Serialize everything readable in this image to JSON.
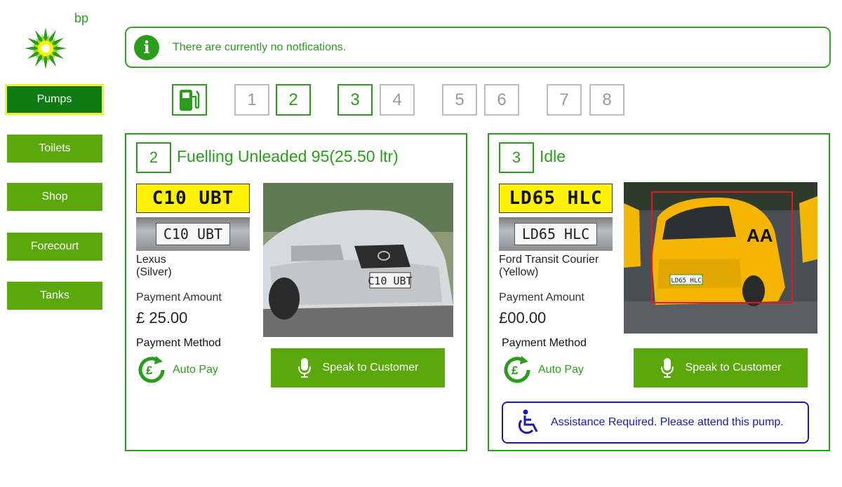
{
  "brand": {
    "logo_text": "bp"
  },
  "colors": {
    "accent": "#2a9d1d",
    "button": "#5ba80d",
    "active_nav": "#0e7b12",
    "highlight": "#f5f028",
    "plate": "#fff200",
    "assist": "#1a1ab0"
  },
  "sidebar": {
    "items": [
      {
        "label": "Pumps",
        "active": true
      },
      {
        "label": "Toilets"
      },
      {
        "label": "Shop"
      },
      {
        "label": "Forecourt"
      },
      {
        "label": "Tanks"
      }
    ]
  },
  "notification": {
    "icon": "info-icon",
    "text": "There are currently no notfications."
  },
  "pump_selector": {
    "icon": "fuel-pump-icon",
    "pumps": [
      {
        "label": "1",
        "active": false
      },
      {
        "label": "2",
        "active": true
      },
      {
        "label": "3",
        "active": true
      },
      {
        "label": "4",
        "active": false
      },
      {
        "label": "5",
        "active": false
      },
      {
        "label": "6",
        "active": false
      },
      {
        "label": "7",
        "active": false
      },
      {
        "label": "8",
        "active": false
      }
    ]
  },
  "cards": [
    {
      "number": "2",
      "status": "Fuelling Unleaded 95(25.50 ltr)",
      "plate": "C10 UBT",
      "plate_crop": "C10 UBT",
      "vehicle_model": "Lexus",
      "vehicle_color": "(Silver)",
      "payment_amount_label": "Payment Amount",
      "payment_amount": "£ 25.00",
      "payment_method_label": "Payment Method",
      "payment_method": "Auto Pay",
      "speak_label": "Speak to Customer"
    },
    {
      "number": "3",
      "status": "Idle",
      "plate": "LD65 HLC",
      "plate_crop": "LD65 HLC",
      "vehicle_model": "Ford Transit Courier",
      "vehicle_color": "(Yellow)",
      "payment_amount_label": "Payment Amount",
      "payment_amount": "£00.00",
      "payment_method_label": "Payment Method",
      "payment_method": "Auto Pay",
      "speak_label": "Speak to Customer",
      "photo_plate": "LD65 HLC",
      "assist_text": "Assistance Required. Please attend this pump."
    }
  ]
}
